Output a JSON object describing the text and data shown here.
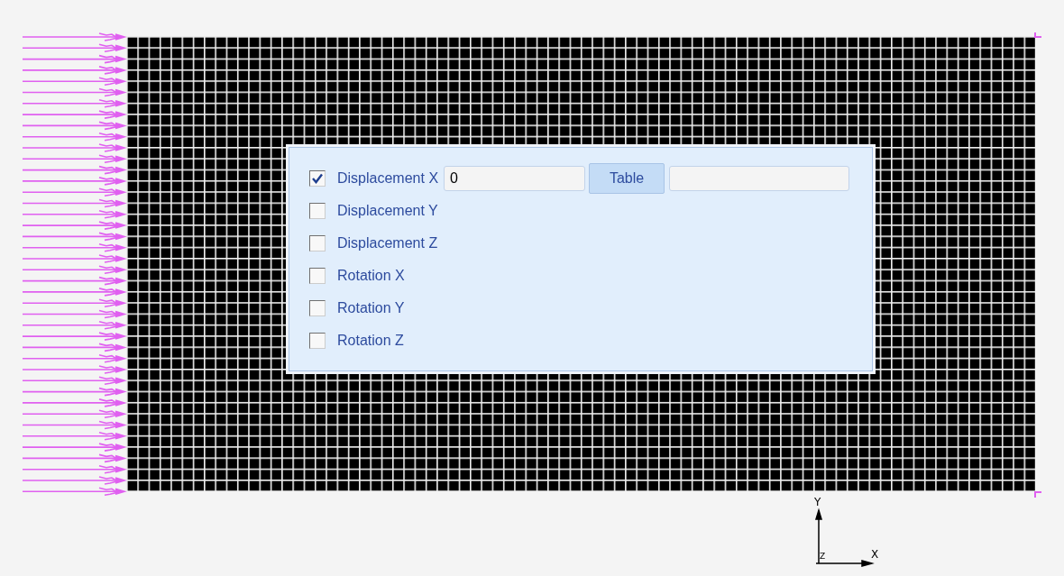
{
  "constraints": [
    {
      "label": "Displacement X",
      "checked": true,
      "kind": "value",
      "value": "0",
      "button": "Table"
    },
    {
      "label": "Displacement Y",
      "checked": false,
      "kind": "plain"
    },
    {
      "label": "Displacement Z",
      "checked": false,
      "kind": "plain"
    },
    {
      "label": "Rotation X",
      "checked": false,
      "kind": "plain"
    },
    {
      "label": "Rotation Y",
      "checked": false,
      "kind": "plain"
    },
    {
      "label": "Rotation Z",
      "checked": false,
      "kind": "plain"
    }
  ],
  "triad": {
    "x_label": "X",
    "y_label": "Y",
    "z_label": "Z"
  }
}
